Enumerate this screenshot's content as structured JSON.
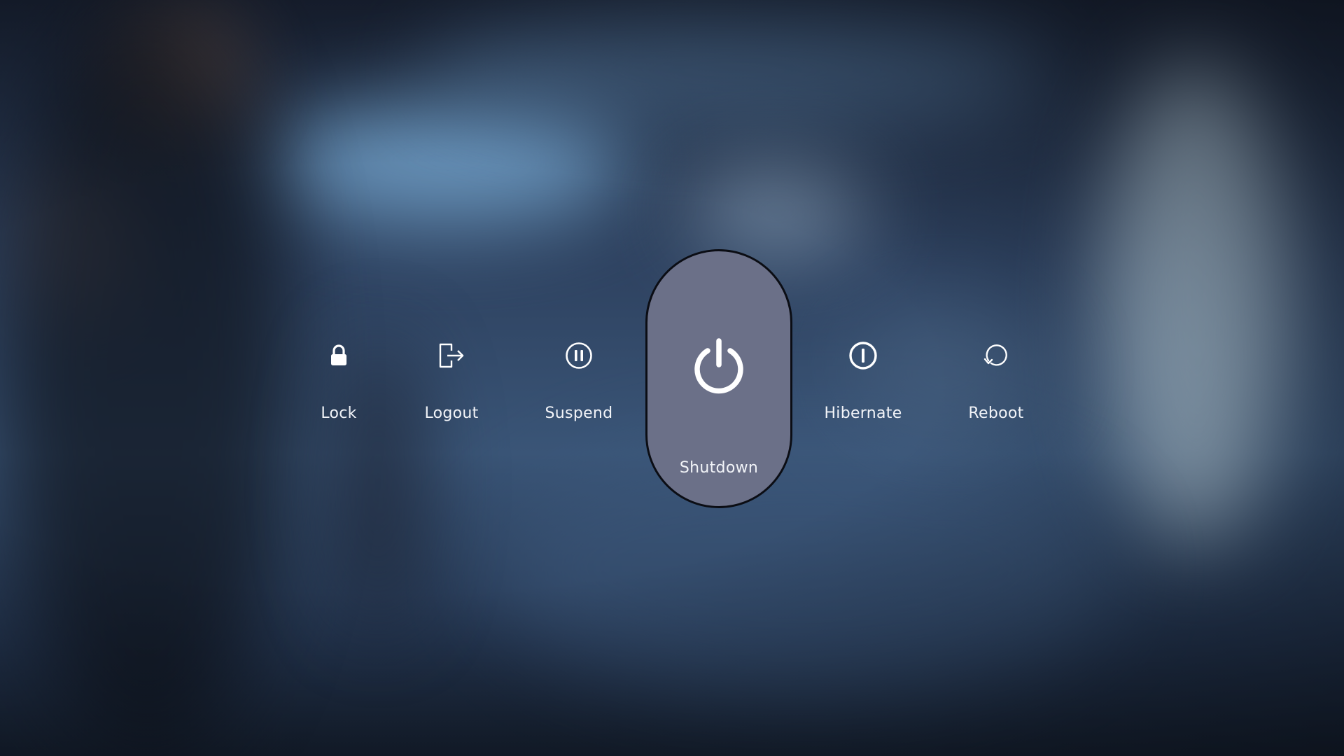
{
  "power_menu": {
    "selected": "shutdown",
    "actions": [
      {
        "id": "lock",
        "label": "Lock",
        "icon": "lock-icon"
      },
      {
        "id": "logout",
        "label": "Logout",
        "icon": "logout-icon"
      },
      {
        "id": "suspend",
        "label": "Suspend",
        "icon": "pause-circle-icon"
      },
      {
        "id": "shutdown",
        "label": "Shutdown",
        "icon": "power-icon"
      },
      {
        "id": "hibernate",
        "label": "Hibernate",
        "icon": "hibernate-icon"
      },
      {
        "id": "reboot",
        "label": "Reboot",
        "icon": "reboot-icon"
      }
    ]
  },
  "colors": {
    "selected_background": "#6b7088",
    "selected_border": "#0b0d14",
    "icon_color": "#ffffff",
    "label_color": "#f2f4f8"
  }
}
